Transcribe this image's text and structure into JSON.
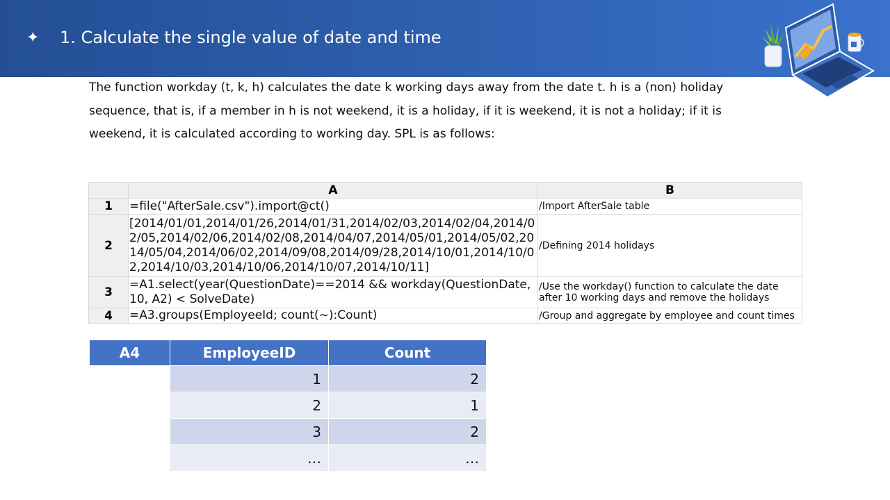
{
  "header": {
    "bullet": "✦",
    "title": "1. Calculate the single value of date and time"
  },
  "intro_text": "The function workday (t, k, h) calculates the date k working days away from the date t. h is a (non) holiday sequence, that is, if a member in h is not weekend, it is a holiday, if it is weekend, it is not a holiday; if it is weekend, it is calculated according to working day. SPL is as follows:",
  "spl": {
    "col_a": "A",
    "col_b": "B",
    "rows": [
      {
        "num": "1",
        "code": "=file(\"AfterSale.csv\").import@ct()",
        "comment": "/Import AfterSale table"
      },
      {
        "num": "2",
        "code": "[2014/01/01,2014/01/26,2014/01/31,2014/02/03,2014/02/04,2014/02/05,2014/02/06,2014/02/08,2014/04/07,2014/05/01,2014/05/02,2014/05/04,2014/06/02,2014/09/08,2014/09/28,2014/10/01,2014/10/02,2014/10/03,2014/10/06,2014/10/07,2014/10/11]",
        "comment": "/Defining 2014 holidays"
      },
      {
        "num": "3",
        "code": "=A1.select(year(QuestionDate)==2014 && workday(QuestionDate, 10, A2) < SolveDate)",
        "comment": "/Use the workday() function to calculate the date after 10 working days and remove the holidays"
      },
      {
        "num": "4",
        "code": "=A3.groups(EmployeeId; count(~):Count)",
        "comment": "/Group and aggregate by employee and count times"
      }
    ]
  },
  "result": {
    "headers": [
      "A4",
      "EmployeeID",
      "Count"
    ],
    "rows": [
      {
        "employee_id": "1",
        "count": "2"
      },
      {
        "employee_id": "2",
        "count": "1"
      },
      {
        "employee_id": "3",
        "count": "2"
      },
      {
        "employee_id": "…",
        "count": "…"
      }
    ]
  },
  "colors": {
    "header_bg": "#2d5eac",
    "table_header": "#4472c4",
    "row_band_dark": "#cfd5ea",
    "row_band_light": "#e9ebf5"
  },
  "icons": [
    "laptop-chart-icon",
    "plant-icon",
    "coffee-mug-icon"
  ]
}
